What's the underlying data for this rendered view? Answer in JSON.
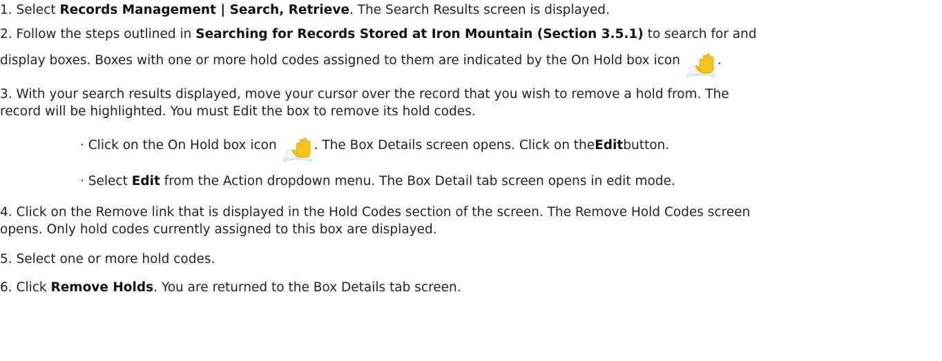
{
  "steps": {
    "s1": {
      "prefix": "1. Select ",
      "bold": "Records Management | Search, Retrieve",
      "suffix": ". The Search Results screen is displayed."
    },
    "s2": {
      "prefix": "2. Follow the steps outlined in ",
      "bold": "Searching for Records Stored at Iron Mountain (Section 3.5.1)",
      "suffix": " to search for and",
      "line2": "display boxes. Boxes with one or more hold codes assigned to them are indicated by the On Hold box icon",
      "line2_end": "."
    },
    "s3": {
      "line1": "3. With your search results displayed, move your cursor over the record that you wish to remove a hold from. The",
      "line2": "record will be highlighted. You must Edit the box to remove its hold codes.",
      "bullet1_prefix": "· Click on the On Hold box icon",
      "bullet1_mid": ". The Box Details screen opens. Click on the ",
      "bullet1_bold": "Edit",
      "bullet1_suffix": " button.",
      "bullet2_prefix": "· Select ",
      "bullet2_bold": "Edit",
      "bullet2_suffix": " from the Action dropdown menu. The Box Detail tab screen opens in edit mode."
    },
    "s4": {
      "line1": "4. Click on the Remove link that is displayed in the Hold Codes section of the screen. The Remove Hold Codes screen",
      "line2": "opens. Only hold codes currently assigned to this box are displayed."
    },
    "s5": {
      "line1": "5. Select one or more hold codes."
    },
    "s6": {
      "prefix": "6. Click ",
      "bold": "Remove Holds",
      "suffix": ". You are returned to the Box Details tab screen."
    }
  },
  "icons": {
    "on_hold": "on-hold-box-icon"
  },
  "colors": {
    "text": "#222222",
    "hand": "#f2c21b",
    "box_edge": "#b9dde3"
  }
}
